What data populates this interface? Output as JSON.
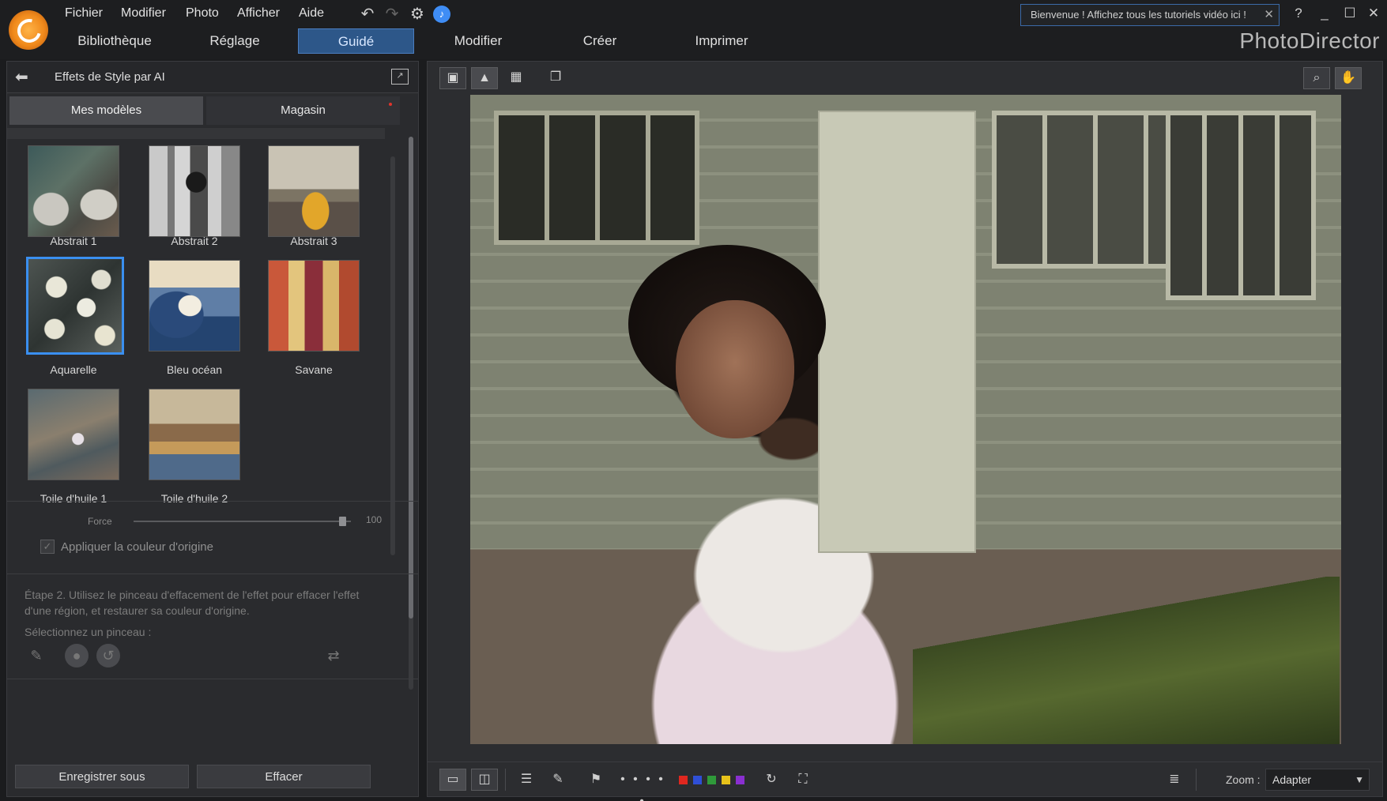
{
  "menu": {
    "items": [
      "Fichier",
      "Modifier",
      "Photo",
      "Afficher",
      "Aide"
    ]
  },
  "tabs": {
    "items": [
      "Bibliothèque",
      "Réglage",
      "Guidé",
      "Modifier",
      "Créer",
      "Imprimer"
    ],
    "active": "Guidé"
  },
  "brand": "PhotoDirector",
  "welcome": {
    "text": "Bienvenue ! Affichez tous les tutoriels vidéo ici !"
  },
  "panel": {
    "title": "Effets de Style par AI",
    "subtabs": [
      "Mes modèles",
      "Magasin"
    ],
    "templates": [
      {
        "label": "Abstrait 1"
      },
      {
        "label": "Abstrait 2"
      },
      {
        "label": "Abstrait 3"
      },
      {
        "label": "Aquarelle",
        "selected": true
      },
      {
        "label": "Bleu océan"
      },
      {
        "label": "Savane"
      },
      {
        "label": "Toile d'huile 1"
      },
      {
        "label": "Toile d'huile 2"
      }
    ],
    "force": {
      "label": "Force",
      "value": "100"
    },
    "apply_original_color": {
      "label": "Appliquer la couleur d'origine",
      "checked": true
    },
    "step_text": "Étape 2. Utilisez le pinceau d'effacement de l'effet pour effacer l'effet d'une région, et restaurer sa couleur d'origine.",
    "brush_label": "Sélectionnez un pinceau :",
    "footer": {
      "save_as": "Enregistrer sous",
      "clear": "Effacer"
    }
  },
  "viewer": {
    "zoom_label": "Zoom :",
    "zoom_value": "Adapter",
    "color_labels": [
      "#e0271f",
      "#2f4fd6",
      "#2f9a3a",
      "#e7c21a",
      "#8a2fd0"
    ]
  },
  "icons": {
    "undo": "undo-icon",
    "redo": "redo-icon",
    "settings": "gear-icon",
    "notification": "bell-icon",
    "help": "help-icon",
    "minimize": "minimize-icon",
    "maximize": "maximize-icon",
    "close": "close-icon"
  }
}
